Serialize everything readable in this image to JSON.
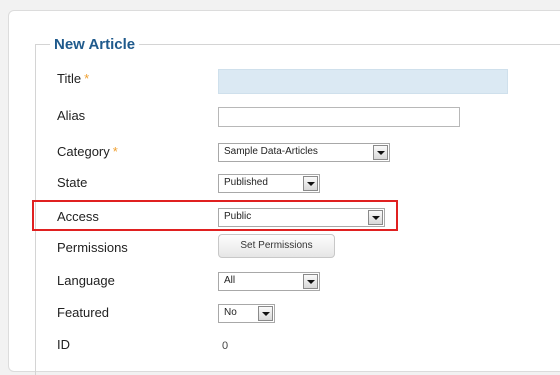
{
  "form": {
    "legend": "New Article",
    "required_marker": "*",
    "fields": {
      "title": {
        "label": "Title",
        "value": ""
      },
      "alias": {
        "label": "Alias",
        "value": ""
      },
      "category": {
        "label": "Category",
        "value": "Sample Data-Articles"
      },
      "state": {
        "label": "State",
        "value": "Published"
      },
      "access": {
        "label": "Access",
        "value": "Public"
      },
      "permissions": {
        "label": "Permissions",
        "button_label": "Set Permissions"
      },
      "language": {
        "label": "Language",
        "value": "All"
      },
      "featured": {
        "label": "Featured",
        "value": "No"
      },
      "id": {
        "label": "ID",
        "value": "0"
      }
    }
  },
  "colors": {
    "legend": "#1f5a8c",
    "required": "#f0a030",
    "title_input_bg": "#dbe9f3",
    "highlight_border": "#e02020"
  }
}
